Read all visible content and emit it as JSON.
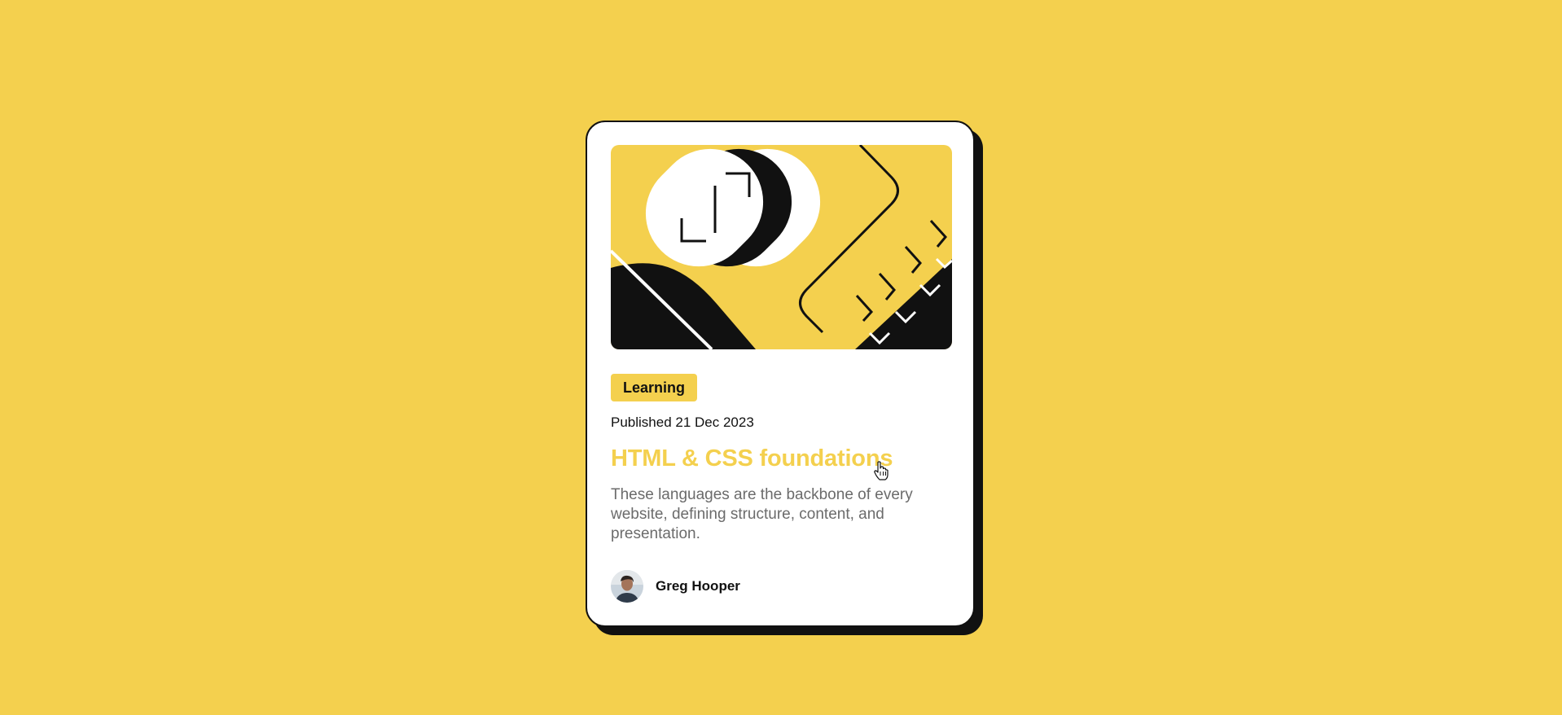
{
  "card": {
    "tag_label": "Learning",
    "published": "Published 21 Dec 2023",
    "title": "HTML & CSS foundations",
    "description": "These languages are the backbone of every website, defining structure, content, and presentation.",
    "author_name": "Greg Hooper"
  },
  "colors": {
    "background": "#f4d04e",
    "card": "#ffffff",
    "ink": "#111111",
    "accent": "#f4d04e",
    "muted_text": "#6b6b6b"
  },
  "icons": {
    "cursor": "hand-pointer-icon"
  }
}
